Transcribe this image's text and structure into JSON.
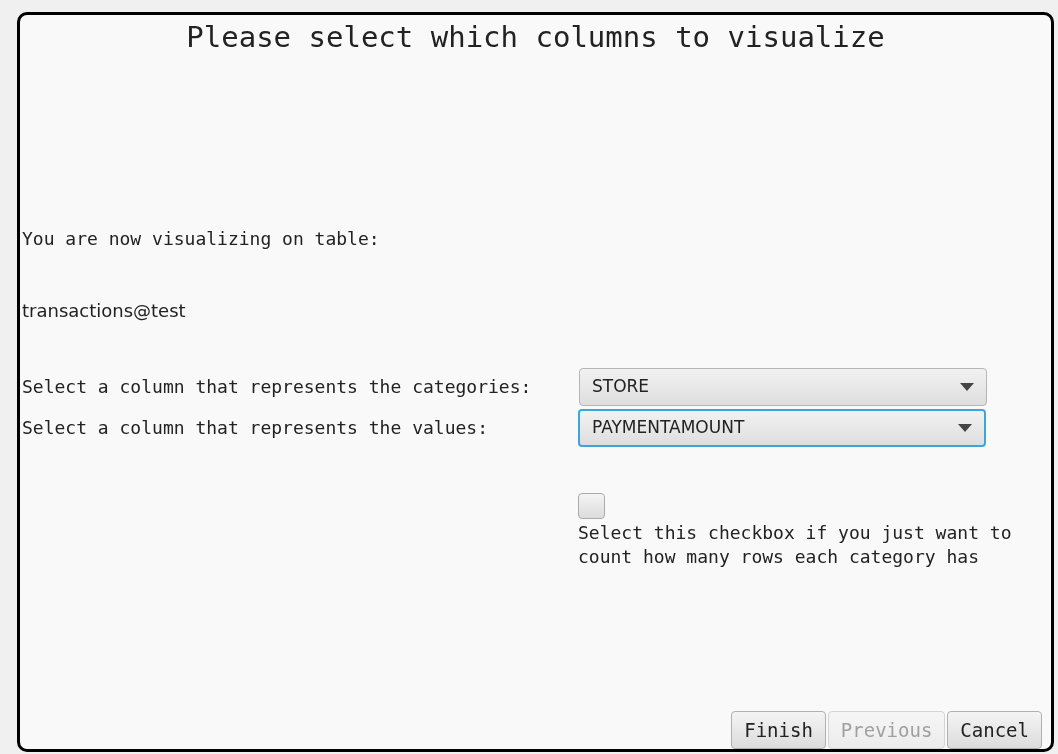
{
  "title": "Please select which columns to visualize",
  "intro": "You are now visualizing on table:",
  "table_name": "transactions@test",
  "selectors": [
    {
      "label": "Select a column that represents the categories:",
      "value": "STORE",
      "focused": false
    },
    {
      "label": "Select a column that represents the values:",
      "value": "PAYMENTAMOUNT",
      "focused": true
    }
  ],
  "count_checkbox": {
    "checked": false,
    "label": "Select this checkbox if you just want to count how many rows each category has"
  },
  "buttons": [
    {
      "label": "Finish",
      "disabled": false
    },
    {
      "label": "Previous",
      "disabled": true
    },
    {
      "label": "Cancel",
      "disabled": false
    }
  ]
}
